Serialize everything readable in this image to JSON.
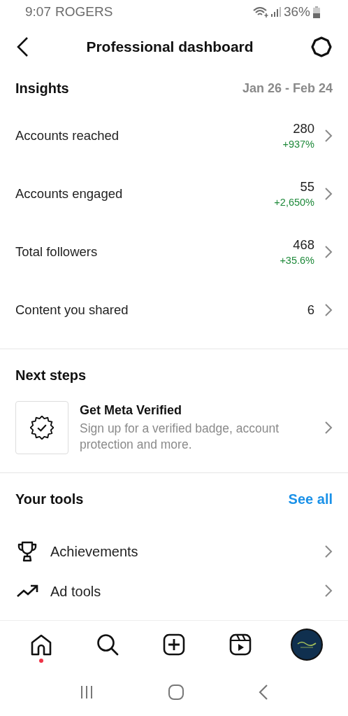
{
  "status_bar": {
    "time": "9:07",
    "carrier": "ROGERS",
    "battery": "36%"
  },
  "header": {
    "title": "Professional dashboard"
  },
  "insights": {
    "title": "Insights",
    "date_range": "Jan 26 - Feb 24",
    "metrics": [
      {
        "label": "Accounts reached",
        "value": "280",
        "change": "+937%"
      },
      {
        "label": "Accounts engaged",
        "value": "55",
        "change": "+2,650%"
      },
      {
        "label": "Total followers",
        "value": "468",
        "change": "+35.6%"
      },
      {
        "label": "Content you shared",
        "value": "6"
      }
    ]
  },
  "next_steps": {
    "title": "Next steps",
    "card": {
      "title": "Get Meta Verified",
      "description": "Sign up for a verified badge, account protection and more."
    }
  },
  "tools": {
    "title": "Your tools",
    "see_all": "See all",
    "items": [
      {
        "label": "Achievements",
        "kind": "trophy"
      },
      {
        "label": "Ad tools",
        "kind": "trend"
      }
    ]
  },
  "bottom_nav": [
    {
      "kind": "home",
      "notification": true
    },
    {
      "kind": "search",
      "notification": false
    },
    {
      "kind": "create",
      "notification": false
    },
    {
      "kind": "reels",
      "notification": false
    },
    {
      "kind": "profile",
      "notification": false
    }
  ],
  "system_nav": [
    {
      "kind": "recents"
    },
    {
      "kind": "home"
    },
    {
      "kind": "back"
    }
  ]
}
